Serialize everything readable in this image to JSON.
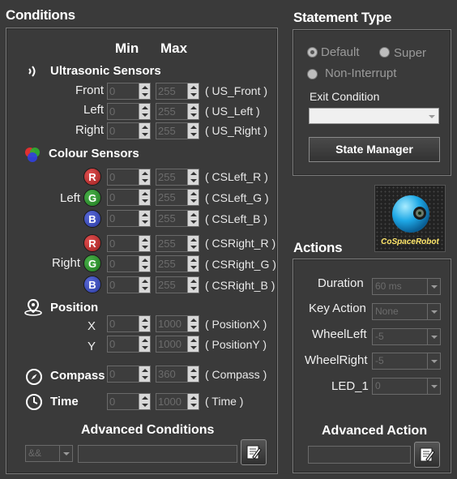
{
  "conditions": {
    "title": "Conditions",
    "min_header": "Min",
    "max_header": "Max",
    "ultrasonic": {
      "title": "Ultrasonic Sensors",
      "rows": [
        {
          "label": "Front",
          "min": "0",
          "max": "255",
          "var": "( US_Front )"
        },
        {
          "label": "Left",
          "min": "0",
          "max": "255",
          "var": "( US_Left )"
        },
        {
          "label": "Right",
          "min": "0",
          "max": "255",
          "var": "( US_Right )"
        }
      ]
    },
    "colour": {
      "title": "Colour Sensors",
      "left_label": "Left",
      "right_label": "Right",
      "channels": [
        "R",
        "G",
        "B"
      ],
      "left_rows": [
        {
          "min": "0",
          "max": "255",
          "var": "( CSLeft_R )"
        },
        {
          "min": "0",
          "max": "255",
          "var": "( CSLeft_G )"
        },
        {
          "min": "0",
          "max": "255",
          "var": "( CSLeft_B )"
        }
      ],
      "right_rows": [
        {
          "min": "0",
          "max": "255",
          "var": "( CSRight_R )"
        },
        {
          "min": "0",
          "max": "255",
          "var": "( CSRight_G )"
        },
        {
          "min": "0",
          "max": "255",
          "var": "( CSRight_B )"
        }
      ]
    },
    "position": {
      "title": "Position",
      "rows": [
        {
          "label": "X",
          "min": "0",
          "max": "1000",
          "var": "( PositionX )"
        },
        {
          "label": "Y",
          "min": "0",
          "max": "1000",
          "var": "( PositionY )"
        }
      ]
    },
    "compass": {
      "title": "Compass",
      "min": "0",
      "max": "360",
      "var": "( Compass )"
    },
    "time": {
      "title": "Time",
      "min": "0",
      "max": "1000",
      "var": "( Time )"
    },
    "advanced": {
      "title": "Advanced  Conditions",
      "operator": "&&",
      "text": ""
    }
  },
  "statement_type": {
    "title": "Statement Type",
    "options": [
      "Default",
      "Super",
      "Non-Interrupt"
    ],
    "selected": "Default",
    "exit_condition_label": "Exit Condition",
    "exit_condition_value": "",
    "state_manager_label": "State Manager"
  },
  "logo": {
    "text": "CoSpaceRobot"
  },
  "actions": {
    "title": "Actions",
    "rows": [
      {
        "label": "Duration",
        "value": "60 ms"
      },
      {
        "label": "Key Action",
        "value": "None"
      },
      {
        "label": "WheelLeft",
        "value": "-5"
      },
      {
        "label": "WheelRight",
        "value": "-5"
      },
      {
        "label": "LED_1",
        "value": "0"
      }
    ],
    "advanced_title": "Advanced Action",
    "advanced_text": ""
  },
  "icons": {
    "ultrasonic": "sound-wave-icon",
    "colour": "rgb-circles-icon",
    "position": "location-pin-icon",
    "compass": "compass-icon",
    "time": "clock-icon",
    "edit": "edit-pen-icon"
  }
}
